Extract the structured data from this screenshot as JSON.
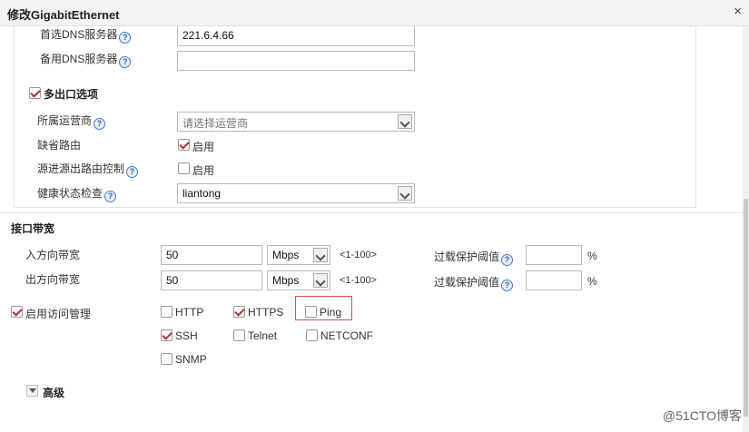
{
  "window": {
    "title": "修改GigabitEthernet",
    "close_glyph": "×"
  },
  "dns": {
    "primary_label": "首选DNS服务器",
    "primary_value": "221.6.4.66",
    "secondary_label": "备用DNS服务器",
    "secondary_value": ""
  },
  "multi_exit": {
    "section_label": "多出口选项",
    "checked": true,
    "carrier_label": "所属运营商",
    "carrier_placeholder": "请选择运营商",
    "default_route_label": "缺省路由",
    "default_route_option": "启用",
    "default_route_checked": true,
    "src_route_label": "源进源出路由控制",
    "src_route_option": "启用",
    "src_route_checked": false,
    "health_label": "健康状态检查",
    "health_value": "liantong"
  },
  "bandwidth": {
    "section_label": "接口带宽",
    "inbound_label": "入方向带宽",
    "inbound_value": "50",
    "inbound_unit": "Mbps",
    "inbound_range": "<1-100>",
    "inbound_threshold_label": "过载保护阈值",
    "inbound_threshold_value": "",
    "percent": "%",
    "outbound_label": "出方向带宽",
    "outbound_value": "50",
    "outbound_unit": "Mbps",
    "outbound_range": "<1-100>",
    "outbound_threshold_label": "过载保护阈值",
    "outbound_threshold_value": ""
  },
  "access": {
    "label": "启用访问管理",
    "checked": true,
    "protocols": [
      {
        "name": "HTTP",
        "checked": false
      },
      {
        "name": "HTTPS",
        "checked": true
      },
      {
        "name": "Ping",
        "checked": false
      },
      {
        "name": "SSH",
        "checked": true
      },
      {
        "name": "Telnet",
        "checked": false
      },
      {
        "name": "NETCONF",
        "checked": false
      },
      {
        "name": "SNMP",
        "checked": false
      }
    ]
  },
  "advanced": {
    "label": "高级"
  },
  "watermark": "@51CTO博客"
}
